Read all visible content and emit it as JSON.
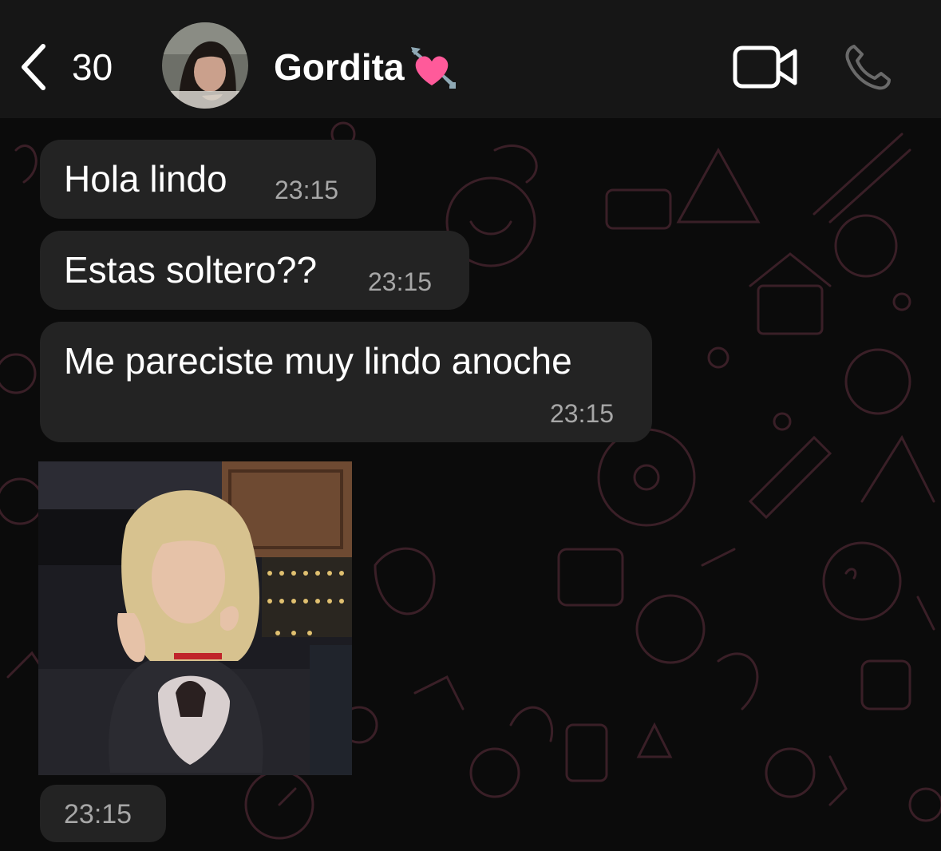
{
  "header": {
    "back_count": "30",
    "contact_name": "Gordita",
    "name_emoji": "heart-with-arrow",
    "icons": {
      "back": "chevron-left-icon",
      "video": "video-camera-icon",
      "call": "phone-icon"
    }
  },
  "messages": [
    {
      "text": "Hola lindo",
      "time": "23:15"
    },
    {
      "text": "Estas soltero??",
      "time": "23:15"
    },
    {
      "text": "Me pareciste muy lindo anoche",
      "time": "23:15"
    }
  ],
  "gif_message": {
    "time": "23:15"
  },
  "colors": {
    "header_bg": "#161616",
    "chat_bg": "#0b0b0b",
    "bubble_bg": "#232323",
    "timestamp": "#a7a7a7",
    "pattern_stroke": "#3a1f27"
  }
}
